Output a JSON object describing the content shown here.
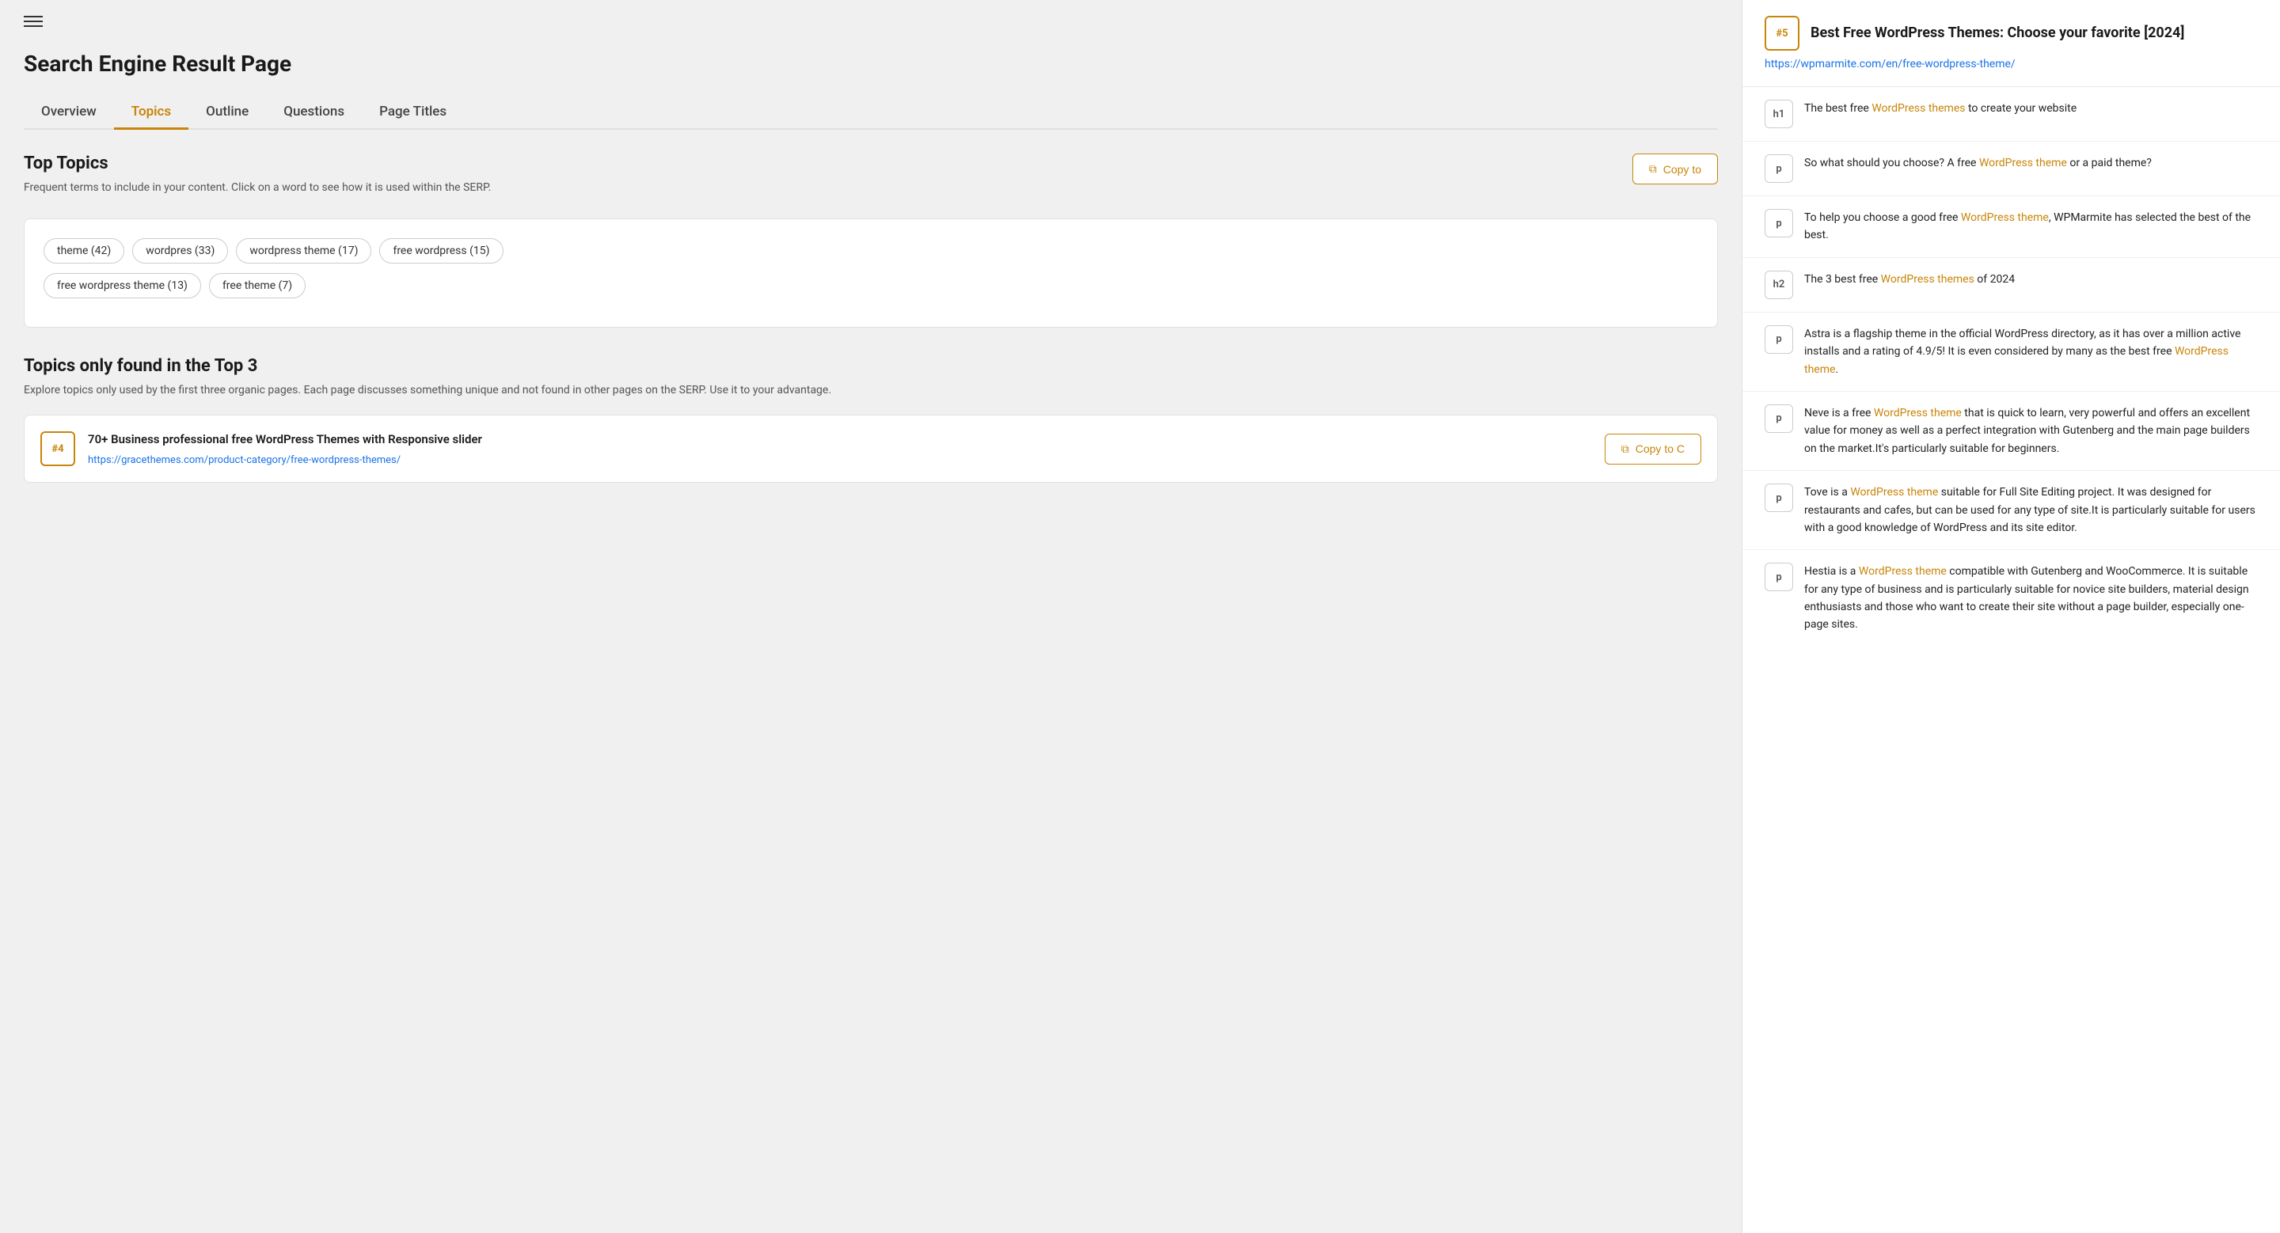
{
  "header": {
    "title": "Search Engine Result Page",
    "hamburger_icon": "☰"
  },
  "tabs": [
    {
      "id": "overview",
      "label": "Overview",
      "active": false
    },
    {
      "id": "topics",
      "label": "Topics",
      "active": true
    },
    {
      "id": "outline",
      "label": "Outline",
      "active": false
    },
    {
      "id": "questions",
      "label": "Questions",
      "active": false
    },
    {
      "id": "page-title",
      "label": "Page Titles",
      "active": false
    }
  ],
  "top_topics": {
    "title": "Top Topics",
    "description": "Frequent terms to include in your content. Click on a word to see how it is used within the SERP.",
    "copy_button": "Copy to",
    "tags": [
      {
        "label": "theme (42)"
      },
      {
        "label": "wordpres (33)"
      },
      {
        "label": "wordpress theme (17)"
      },
      {
        "label": "free wordpress (15)"
      },
      {
        "label": "free wordpress theme (13)"
      },
      {
        "label": "free theme (7)"
      }
    ]
  },
  "top3": {
    "title": "Topics only found in the Top 3",
    "description": "Explore topics only used by the first three organic pages. Each page discusses something unique and not found in other pages on the SERP. Use it to your advantage.",
    "card": {
      "rank": "#4",
      "title": "70+ Business professional free WordPress Themes with Responsive slider",
      "url": "https://gracethemes.com/product-category/free-wordpress-themes/",
      "copy_button": "Copy to C"
    }
  },
  "right_panel": {
    "entry": {
      "rank": "#5",
      "title": "Best Free WordPress Themes: Choose your favorite [2024]",
      "url": "https://wpmarmite.com/en/free-wordpress-theme/"
    },
    "rows": [
      {
        "tag": "h1",
        "text_parts": [
          {
            "text": "The best free ",
            "highlight": false
          },
          {
            "text": "WordPress themes",
            "highlight": true
          },
          {
            "text": " to create your website",
            "highlight": false
          }
        ]
      },
      {
        "tag": "p",
        "text_parts": [
          {
            "text": "So what should you choose? A free ",
            "highlight": false
          },
          {
            "text": "WordPress theme",
            "highlight": true
          },
          {
            "text": " or a paid theme?",
            "highlight": false
          }
        ]
      },
      {
        "tag": "p",
        "text_parts": [
          {
            "text": "To help you choose a good free ",
            "highlight": false
          },
          {
            "text": "WordPress theme",
            "highlight": true
          },
          {
            "text": ", WPMarmite has selected the best of the best.",
            "highlight": false
          }
        ]
      },
      {
        "tag": "h2",
        "text_parts": [
          {
            "text": "The 3 best free ",
            "highlight": false
          },
          {
            "text": "WordPress themes",
            "highlight": true
          },
          {
            "text": " of 2024",
            "highlight": false
          }
        ]
      },
      {
        "tag": "p",
        "text_parts": [
          {
            "text": "Astra is a flagship theme in the official WordPress directory, as it has over a million active installs and a rating of 4.9/5! It is even considered by many as the best free ",
            "highlight": false
          },
          {
            "text": "WordPress theme",
            "highlight": true
          },
          {
            "text": ".",
            "highlight": false
          }
        ]
      },
      {
        "tag": "p",
        "text_parts": [
          {
            "text": "Neve is a free ",
            "highlight": false
          },
          {
            "text": "WordPress theme",
            "highlight": true
          },
          {
            "text": " that is quick to learn, very powerful and offers an excellent value for money as well as a perfect integration with Gutenberg and the main page builders on the market.It's particularly suitable for beginners.",
            "highlight": false
          }
        ]
      },
      {
        "tag": "p",
        "text_parts": [
          {
            "text": "Tove is a ",
            "highlight": false
          },
          {
            "text": "WordPress theme",
            "highlight": true
          },
          {
            "text": " suitable for Full Site Editing project. It was designed for restaurants and cafes, but can be used for any type of site.It is particularly suitable for users with a good knowledge of WordPress and its site editor.",
            "highlight": false
          }
        ]
      },
      {
        "tag": "p",
        "text_parts": [
          {
            "text": "Hestia is a ",
            "highlight": false
          },
          {
            "text": "WordPress theme",
            "highlight": true
          },
          {
            "text": " compatible with Gutenberg and WooCommerce. It is suitable for any type of business and is particularly suitable for novice site builders, material design enthusiasts and those who want to create their site without a page builder, especially one-page sites.",
            "highlight": false
          }
        ]
      }
    ]
  }
}
